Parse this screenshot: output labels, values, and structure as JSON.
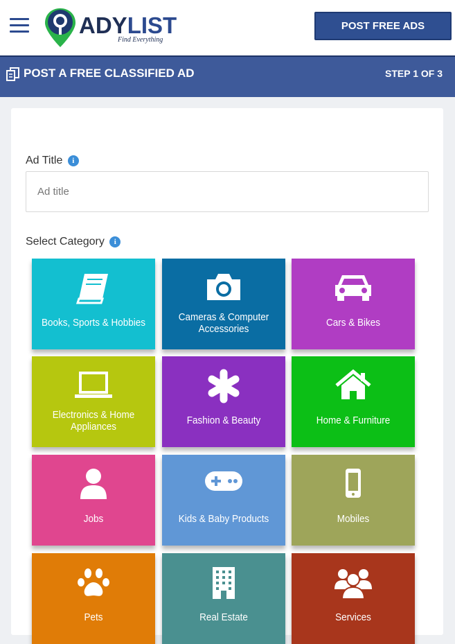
{
  "header": {
    "logo_text_a": "ADY",
    "logo_text_b": "LIST",
    "logo_tagline": "Find Everything",
    "post_button": "POST FREE ADS"
  },
  "titlebar": {
    "title": "POST A FREE CLASSIFIED AD",
    "step": "STEP 1 OF 3"
  },
  "form": {
    "ad_title_label": "Ad Title",
    "ad_title_placeholder": "Ad title",
    "ad_title_value": "",
    "category_label": "Select Category"
  },
  "categories": [
    {
      "label": "Books, Sports & Hobbies",
      "color": "#13bfd0",
      "icon": "book-icon"
    },
    {
      "label": "Cameras & Computer Accessories",
      "color": "#0a6da3",
      "icon": "camera-icon"
    },
    {
      "label": "Cars & Bikes",
      "color": "#b03dc3",
      "icon": "car-icon"
    },
    {
      "label": "Electronics & Home Appliances",
      "color": "#b6c70f",
      "icon": "laptop-icon"
    },
    {
      "label": "Fashion & Beauty",
      "color": "#8a30c0",
      "icon": "asterisk-icon"
    },
    {
      "label": "Home & Furniture",
      "color": "#0cbf16",
      "icon": "house-icon"
    },
    {
      "label": "Jobs",
      "color": "#e0468f",
      "icon": "person-icon"
    },
    {
      "label": "Kids & Baby Products",
      "color": "#6097d6",
      "icon": "gamepad-icon"
    },
    {
      "label": "Mobiles",
      "color": "#9ea55a",
      "icon": "mobile-icon"
    },
    {
      "label": "Pets",
      "color": "#e07c07",
      "icon": "paw-icon"
    },
    {
      "label": "Real Estate",
      "color": "#4a9090",
      "icon": "building-icon"
    },
    {
      "label": "Services",
      "color": "#a8361c",
      "icon": "group-icon"
    }
  ]
}
